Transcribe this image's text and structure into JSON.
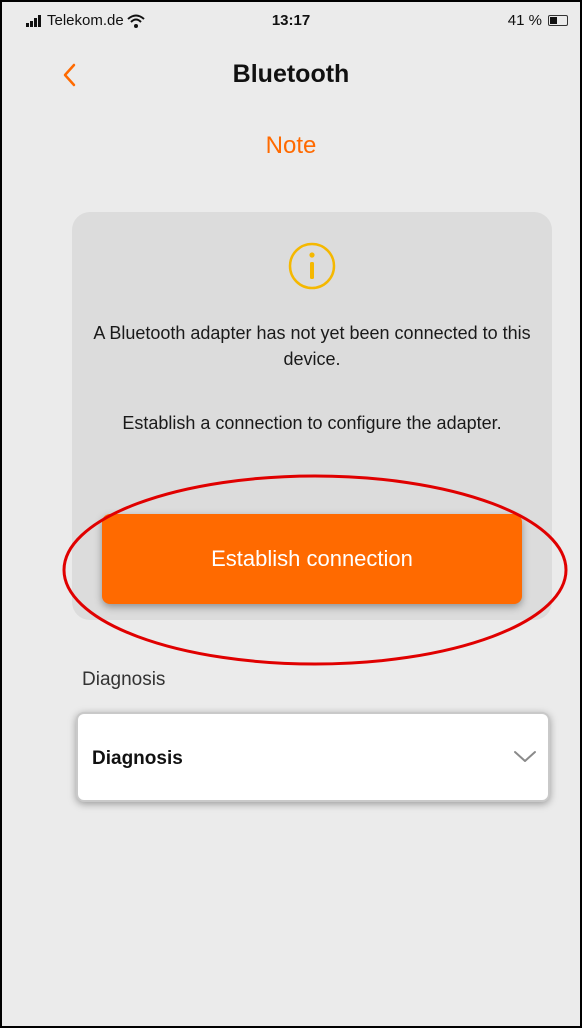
{
  "status_bar": {
    "carrier": "Telekom.de",
    "time": "13:17",
    "battery": "41 %"
  },
  "nav": {
    "title": "Bluetooth",
    "back_icon": "chevron-left-icon"
  },
  "note": {
    "title": "Note",
    "icon": "info-icon",
    "message_line1": "A Bluetooth adapter has not yet been connected to this device.",
    "message_line2": "Establish a connection to configure the adapter.",
    "button_label": "Establish connection"
  },
  "diagnosis": {
    "label": "Diagnosis",
    "selected_value": "Diagnosis",
    "dropdown_icon": "chevron-down-icon"
  },
  "colors": {
    "accent": "#ff6a00",
    "info_icon": "#f5b800",
    "highlight": "#e00000"
  }
}
